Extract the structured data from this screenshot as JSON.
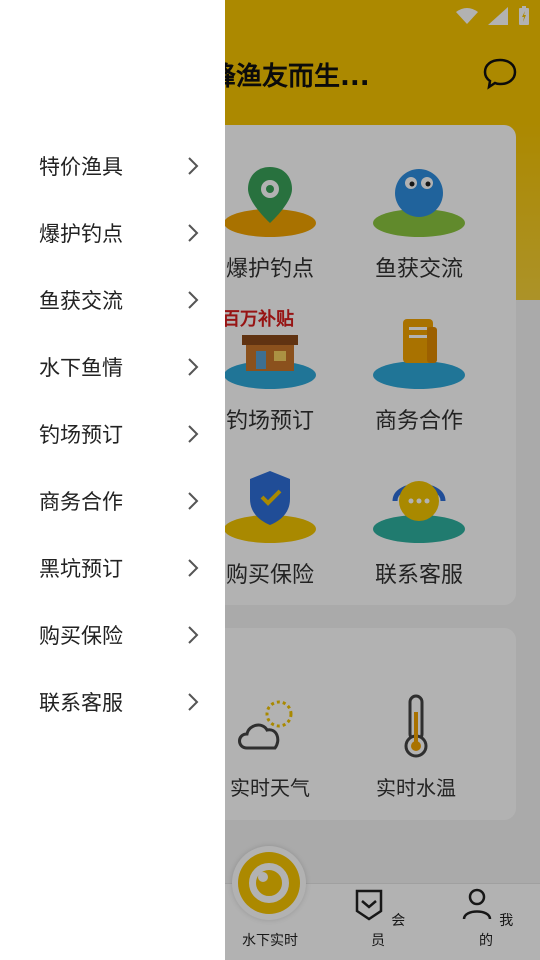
{
  "header": {
    "title": "峰渔友而生..."
  },
  "features": [
    {
      "label": "爆护钓点",
      "icon": "map-pin-icon"
    },
    {
      "label": "鱼获交流",
      "icon": "fish-chat-icon"
    },
    {
      "label": "钓场预订",
      "icon": "fishing-shop-icon",
      "badge": "百万补贴"
    },
    {
      "label": "商务合作",
      "icon": "document-icon"
    },
    {
      "label": "购买保险",
      "icon": "shield-icon"
    },
    {
      "label": "联系客服",
      "icon": "headset-icon"
    }
  ],
  "tools": [
    {
      "label": "实时天气",
      "icon": "weather-icon"
    },
    {
      "label": "实时水温",
      "icon": "thermometer-icon"
    }
  ],
  "bottom_nav": [
    {
      "label": "水下实时",
      "icon": "camera-icon"
    },
    {
      "label": "会员",
      "icon": "member-icon"
    },
    {
      "label": "我的",
      "icon": "profile-icon"
    }
  ],
  "drawer": {
    "items": [
      {
        "label": "特价渔具"
      },
      {
        "label": "爆护钓点"
      },
      {
        "label": "鱼获交流"
      },
      {
        "label": "水下鱼情"
      },
      {
        "label": "钓场预订"
      },
      {
        "label": "商务合作"
      },
      {
        "label": "黑坑预订"
      },
      {
        "label": "购买保险"
      },
      {
        "label": "联系客服"
      }
    ]
  },
  "colors": {
    "brand_yellow": "#f7c400",
    "overlay": "rgba(0,0,0,0.30)"
  }
}
